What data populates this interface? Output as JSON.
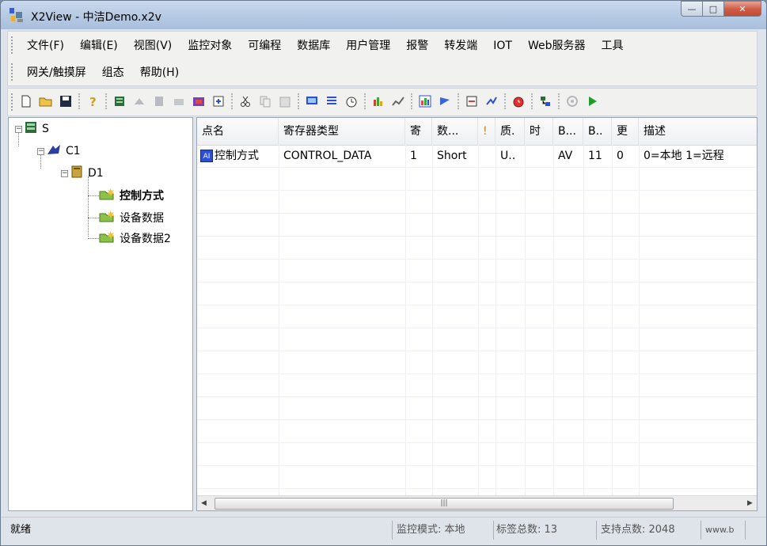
{
  "window": {
    "title": "X2View - 中洁Demo.x2v",
    "min_glyph": "—",
    "max_glyph": "□",
    "close_glyph": "✕"
  },
  "menu": {
    "row1": [
      {
        "label": "文件(F)"
      },
      {
        "label": "编辑(E)"
      },
      {
        "label": "视图(V)"
      },
      {
        "label": "监控对象"
      },
      {
        "label": "可编程"
      },
      {
        "label": "数据库"
      },
      {
        "label": "用户管理"
      },
      {
        "label": "报警"
      },
      {
        "label": "转发端"
      },
      {
        "label": "IOT"
      },
      {
        "label": "Web服务器"
      },
      {
        "label": "工具"
      }
    ],
    "row2": [
      {
        "label": "网关/触摸屏"
      },
      {
        "label": "组态"
      },
      {
        "label": "帮助(H)"
      }
    ]
  },
  "toolbar": {
    "icons": [
      "new-file",
      "open-folder",
      "save",
      "help",
      "add-server",
      "add-channel",
      "add-device",
      "add-tag",
      "import-db",
      "properties",
      "cut",
      "copy",
      "paste",
      "monitor",
      "list-view",
      "timer",
      "run-report",
      "trend",
      "calc",
      "chart",
      "export",
      "graph",
      "settings",
      "alarm-clock",
      "network",
      "disabled-gear",
      "run"
    ]
  },
  "tree": {
    "root": {
      "label": "S"
    },
    "channel": {
      "label": "C1"
    },
    "device": {
      "label": "D1"
    },
    "groups": [
      {
        "label": "控制方式",
        "bold": true
      },
      {
        "label": "设备数据",
        "bold": false
      },
      {
        "label": "设备数据2",
        "bold": false
      }
    ]
  },
  "grid": {
    "columns": [
      {
        "label": "点名"
      },
      {
        "label": "寄存器类型"
      },
      {
        "label": "寄"
      },
      {
        "label": "数..."
      },
      {
        "label": "!"
      },
      {
        "label": "质."
      },
      {
        "label": "时"
      },
      {
        "label": "B..."
      },
      {
        "label": "B.."
      },
      {
        "label": "更"
      },
      {
        "label": "描述"
      }
    ],
    "rows": [
      {
        "icon": "analog-point",
        "icon_text": "AI",
        "cells": [
          "控制方式",
          "CONTROL_DATA",
          "1",
          "Short",
          "",
          "U..",
          "",
          "AV",
          "11",
          "0",
          "0=本地 1=远程"
        ]
      }
    ],
    "scroll_center_glyph": "|||"
  },
  "status": {
    "ready": "就绪",
    "mode": "监控模式: 本地",
    "tag_count": "标签总数: 13",
    "support": "支持点数: 2048",
    "website": "www.b"
  },
  "colors": {
    "title_gradient": "#b4c8e2",
    "close_red": "#c44a33",
    "icon_blue": "#2b4fd6"
  }
}
